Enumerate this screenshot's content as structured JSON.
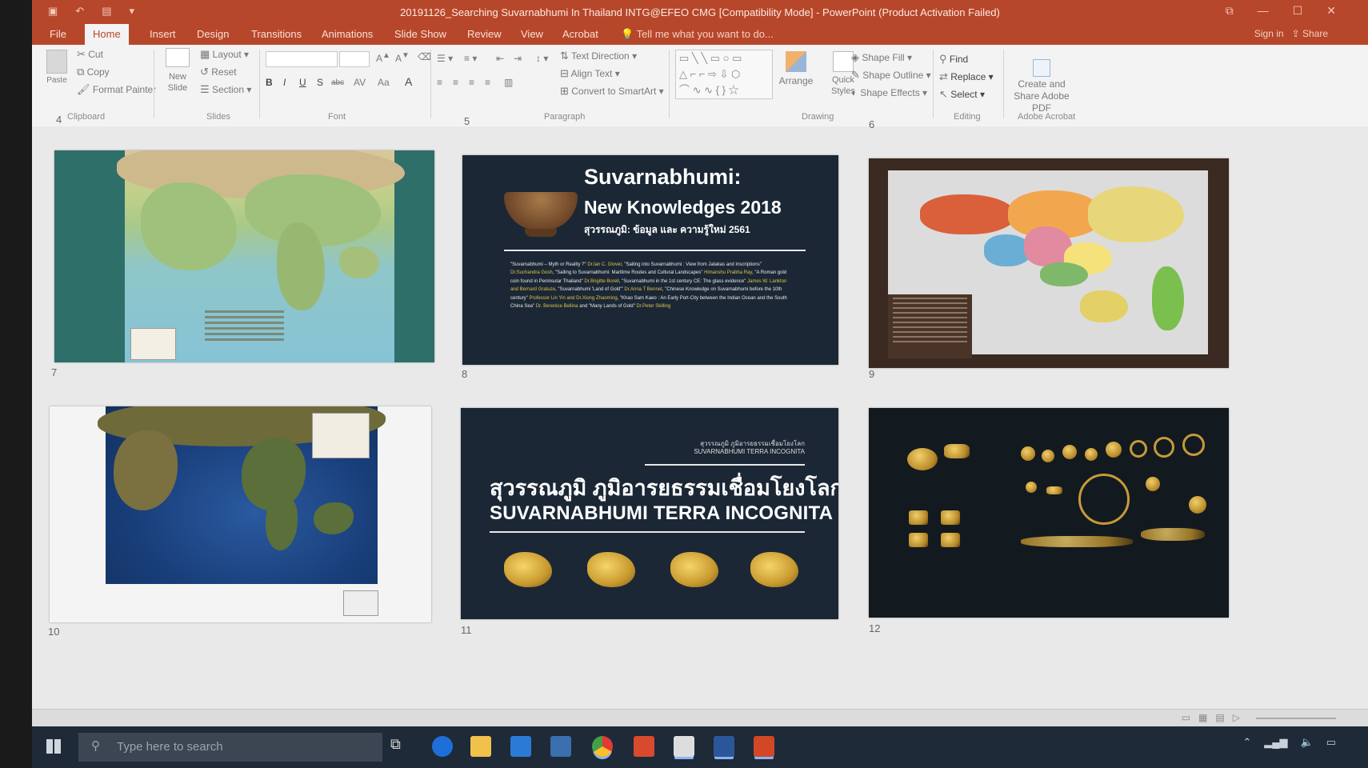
{
  "window": {
    "title": "20191126_Searching Suvarnabhumi In Thailand INTG@EFEO CMG [Compatibility Mode] - PowerPoint (Product Activation Failed)",
    "signin": "Sign in",
    "share": "Share"
  },
  "ribbon": {
    "tabs": [
      "File",
      "Home",
      "Insert",
      "Design",
      "Transitions",
      "Animations",
      "Slide Show",
      "Review",
      "View",
      "Acrobat"
    ],
    "active_tab": "Home",
    "tell_me": "Tell me what you want to do...",
    "clipboard": {
      "paste": "Paste",
      "cut": "Cut",
      "copy": "Copy",
      "format_painter": "Format Painter",
      "label": "Clipboard"
    },
    "slides": {
      "new_slide": "New Slide",
      "layout": "Layout",
      "reset": "Reset",
      "section": "Section",
      "label": "Slides"
    },
    "font": {
      "label": "Font",
      "bold": "B",
      "italic": "I",
      "underline": "U",
      "strike": "S",
      "shadow": "abc",
      "spacing": "AV",
      "case": "Aa",
      "color": "A"
    },
    "paragraph": {
      "text_direction": "Text Direction",
      "align_text": "Align Text",
      "convert_smartart": "Convert to SmartArt",
      "label": "Paragraph"
    },
    "drawing": {
      "arrange": "Arrange",
      "quick_styles": "Quick Styles",
      "shape_fill": "Shape Fill",
      "shape_outline": "Shape Outline",
      "shape_effects": "Shape Effects",
      "label": "Drawing"
    },
    "editing": {
      "find": "Find",
      "replace": "Replace",
      "select": "Select",
      "label": "Editing"
    },
    "acrobat": {
      "create_share": "Create and Share Adobe PDF",
      "label": "Adobe Acrobat"
    }
  },
  "sorter": {
    "top_numbers": [
      "4",
      "5",
      "6"
    ],
    "slide_numbers": [
      "7",
      "8",
      "9",
      "10",
      "11",
      "12"
    ]
  },
  "slide8": {
    "title1": "Suvarnabhumi:",
    "title2": "New Knowledges 2018",
    "subtitle_thai": "สุวรรณภูมิ: ข้อมูล และ ความรู้ใหม่ 2561",
    "body_parts": [
      {
        "t": "\"Suvarnabhumi – Myth or Reality ?\" ",
        "c": "w"
      },
      {
        "t": "Dr.Ian C. Glover",
        "c": "y"
      },
      {
        "t": ", \"Sailing into Suvarnabhumi : View from Jatakas and Inscriptions\" ",
        "c": "w"
      },
      {
        "t": "Dr.Suchandra Gosh",
        "c": "y"
      },
      {
        "t": ", \"Sailing to Suvarnabhumi: Maritime Routes and Cultural Landscapes\" ",
        "c": "w"
      },
      {
        "t": "Himanshu Prabha Ray",
        "c": "y"
      },
      {
        "t": ", \"A Roman gold coin found in Peninsular Thailand\" ",
        "c": "w"
      },
      {
        "t": "Dr.Brigitte Borell",
        "c": "y"
      },
      {
        "t": ", \"Suvarnabhumi in the 1st century CE: The glass evidence\" ",
        "c": "w"
      },
      {
        "t": "James W. Lankton and Bernard Gratuze",
        "c": "y"
      },
      {
        "t": ", \"Suvarnabhumi 'Land of Gold'\" ",
        "c": "w"
      },
      {
        "t": "Dr.Anna T Bennet",
        "c": "y"
      },
      {
        "t": ", \"Chinese Knowledge on Suvarnabhumi before the 10th century\" ",
        "c": "w"
      },
      {
        "t": "Professor Lin Yin and Dr.Xiong Zhaoming",
        "c": "y"
      },
      {
        "t": ", \"Khao Sam Kaeo : An Early Port-City between the Indian Ocean and the South China Sea\" ",
        "c": "w"
      },
      {
        "t": "Dr. Berenice Bellina",
        "c": "y"
      },
      {
        "t": " and \"Many Lands of Gold\" ",
        "c": "w"
      },
      {
        "t": "Dr.Peter Skilling",
        "c": "y"
      }
    ]
  },
  "slide11": {
    "small_thai": "สุวรรณภูมิ ภูมิอารยธรรมเชื่อมโยงโลก",
    "small_eng": "SUVARNABHUMI TERRA INCOGNITA",
    "title_thai": "สุวรรณภูมิ ภูมิอารยธรรมเชื่อมโยงโลก",
    "title_eng": "SUVARNABHUMI TERRA INCOGNITA"
  },
  "taskbar": {
    "search_placeholder": "Type here to search",
    "apps": [
      "task-view",
      "edge",
      "file-explorer",
      "store",
      "mail",
      "chrome",
      "app-red",
      "photos",
      "word",
      "powerpoint"
    ]
  },
  "colors": {
    "powerpoint_red": "#b7472a",
    "slide_navy": "#1b2735",
    "gold_text": "#e0c34a"
  }
}
